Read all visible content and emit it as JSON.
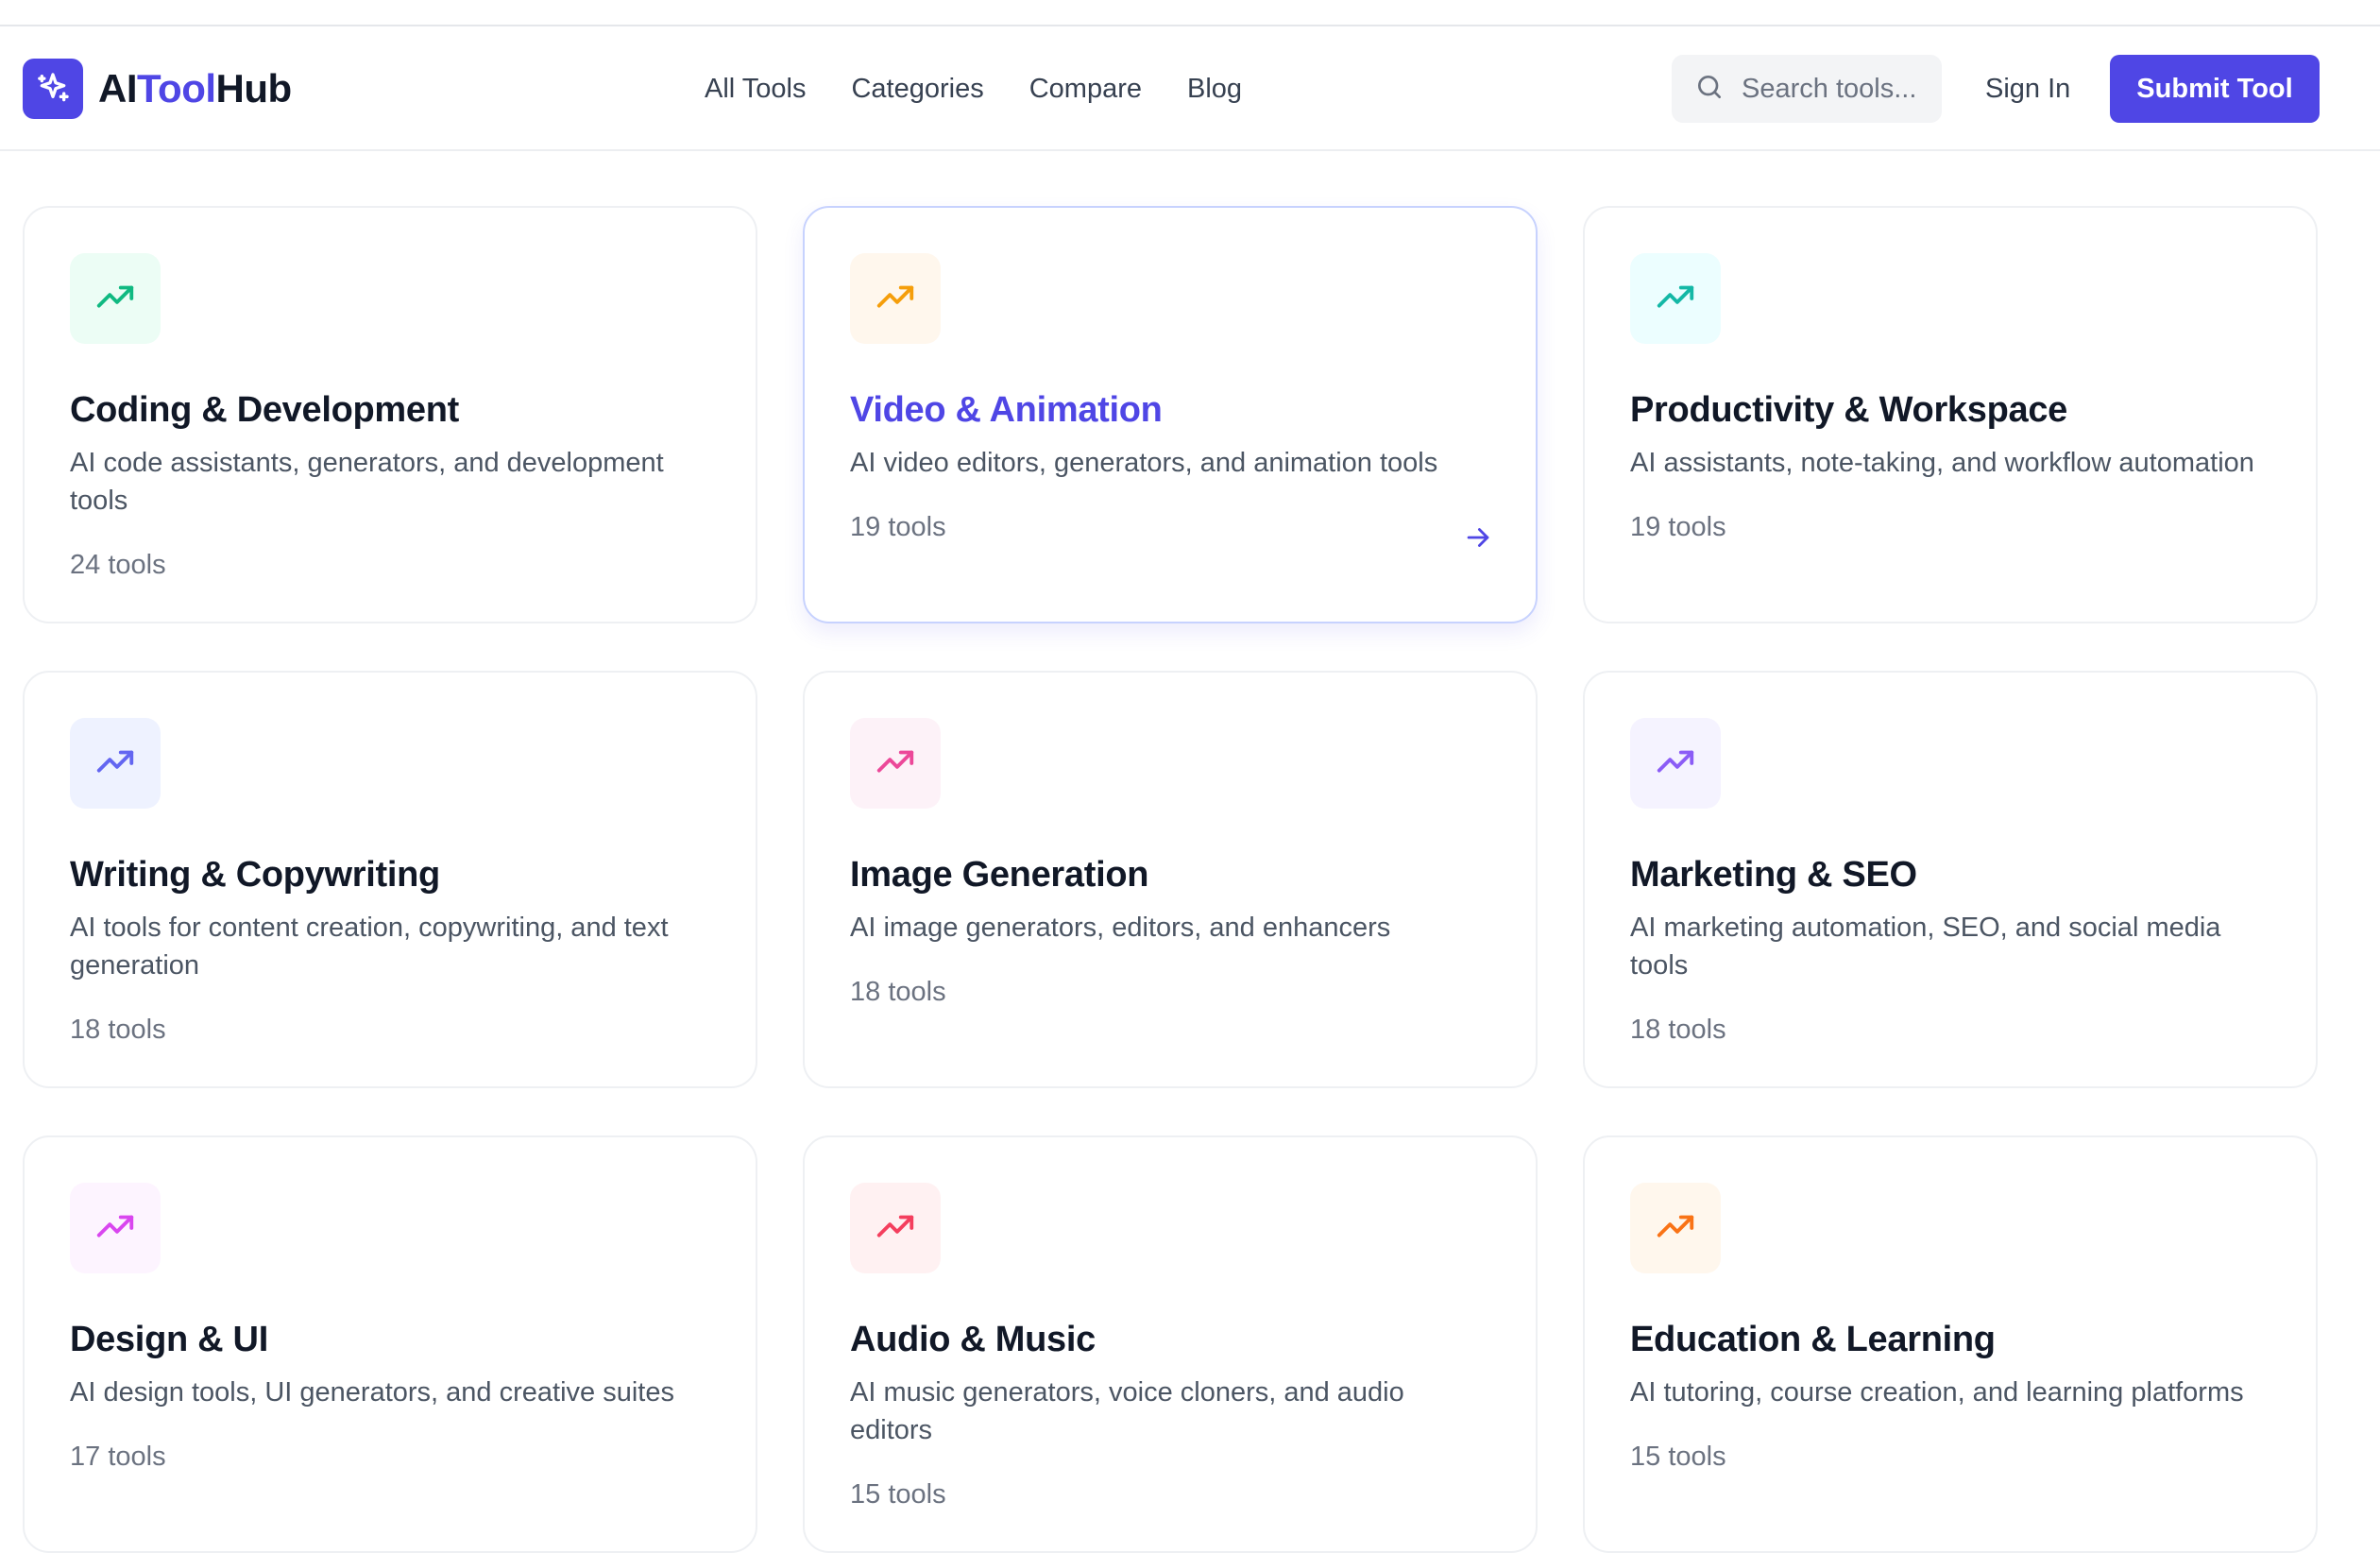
{
  "brand": {
    "name_ai": "AI",
    "name_tool": "Tool",
    "name_hub": "Hub",
    "logo_icon": "sparkles-icon",
    "accent": "#4f46e5"
  },
  "nav": {
    "items": [
      "All Tools",
      "Categories",
      "Compare",
      "Blog"
    ]
  },
  "search": {
    "placeholder": "Search tools...",
    "icon": "search-icon"
  },
  "auth": {
    "sign_in": "Sign In",
    "submit": "Submit Tool"
  },
  "categories": [
    {
      "title": "Coding & Development",
      "description": "AI code assistants, generators, and development tools",
      "count": "24 tools",
      "icon": "trending-up-icon",
      "color": "#10b981",
      "bg": "#ecfdf5"
    },
    {
      "title": "Video & Animation",
      "description": "AI video editors, generators, and animation tools",
      "count": "19 tools",
      "icon": "trending-up-icon",
      "color": "#f59e0b",
      "bg": "#fff7ed",
      "active": true
    },
    {
      "title": "Productivity & Workspace",
      "description": "AI assistants, note-taking, and workflow automation",
      "count": "19 tools",
      "icon": "trending-up-icon",
      "color": "#14b8a6",
      "bg": "#ecfeff"
    },
    {
      "title": "Writing & Copywriting",
      "description": "AI tools for content creation, copywriting, and text generation",
      "count": "18 tools",
      "icon": "trending-up-icon",
      "color": "#6366f1",
      "bg": "#eef2ff"
    },
    {
      "title": "Image Generation",
      "description": "AI image generators, editors, and enhancers",
      "count": "18 tools",
      "icon": "trending-up-icon",
      "color": "#ec4899",
      "bg": "#fdf2f8"
    },
    {
      "title": "Marketing & SEO",
      "description": "AI marketing automation, SEO, and social media tools",
      "count": "18 tools",
      "icon": "trending-up-icon",
      "color": "#8b5cf6",
      "bg": "#f5f3ff"
    },
    {
      "title": "Design & UI",
      "description": "AI design tools, UI generators, and creative suites",
      "count": "17 tools",
      "icon": "trending-up-icon",
      "color": "#d946ef",
      "bg": "#fdf4ff"
    },
    {
      "title": "Audio & Music",
      "description": "AI music generators, voice cloners, and audio editors",
      "count": "15 tools",
      "icon": "trending-up-icon",
      "color": "#f43f5e",
      "bg": "#fff1f2"
    },
    {
      "title": "Education & Learning",
      "description": "AI tutoring, course creation, and learning platforms",
      "count": "15 tools",
      "icon": "trending-up-icon",
      "color": "#f97316",
      "bg": "#fff7ed"
    }
  ]
}
